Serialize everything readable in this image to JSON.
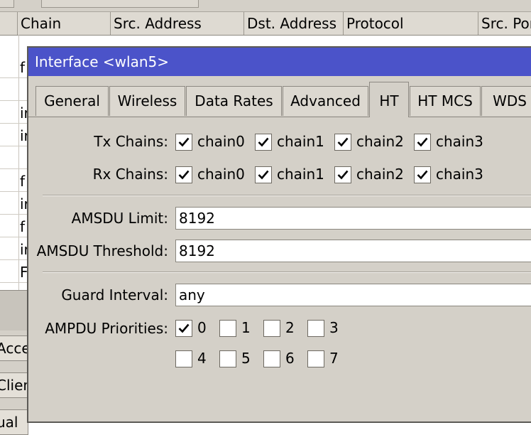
{
  "background_table": {
    "columns": [
      "Chain",
      "Src. Address",
      "Dst. Address",
      "Protocol",
      "Src. Por"
    ],
    "row_letters": [
      "f",
      "",
      "ir",
      "ir",
      "",
      "f",
      "ir",
      "f",
      "ir",
      "F"
    ],
    "buttons": [
      "Acces",
      "Client",
      "ual"
    ]
  },
  "dialog": {
    "title": "Interface <wlan5>",
    "tabs": [
      "General",
      "Wireless",
      "Data Rates",
      "Advanced",
      "HT",
      "HT MCS",
      "WDS"
    ],
    "active_tab": "HT",
    "tx_chains": {
      "label": "Tx Chains:",
      "items": [
        {
          "label": "chain0",
          "checked": true
        },
        {
          "label": "chain1",
          "checked": true
        },
        {
          "label": "chain2",
          "checked": true
        },
        {
          "label": "chain3",
          "checked": true
        }
      ]
    },
    "rx_chains": {
      "label": "Rx Chains:",
      "items": [
        {
          "label": "chain0",
          "checked": true
        },
        {
          "label": "chain1",
          "checked": true
        },
        {
          "label": "chain2",
          "checked": true
        },
        {
          "label": "chain3",
          "checked": true
        }
      ]
    },
    "amsdu_limit": {
      "label": "AMSDU Limit:",
      "value": "8192"
    },
    "amsdu_threshold": {
      "label": "AMSDU Threshold:",
      "value": "8192"
    },
    "guard_interval": {
      "label": "Guard Interval:",
      "value": "any"
    },
    "ampdu_priorities": {
      "label": "AMPDU Priorities:",
      "items": [
        {
          "label": "0",
          "checked": true
        },
        {
          "label": "1",
          "checked": false
        },
        {
          "label": "2",
          "checked": false
        },
        {
          "label": "3",
          "checked": false
        },
        {
          "label": "4",
          "checked": false
        },
        {
          "label": "5",
          "checked": false
        },
        {
          "label": "6",
          "checked": false
        },
        {
          "label": "7",
          "checked": false
        }
      ]
    }
  }
}
